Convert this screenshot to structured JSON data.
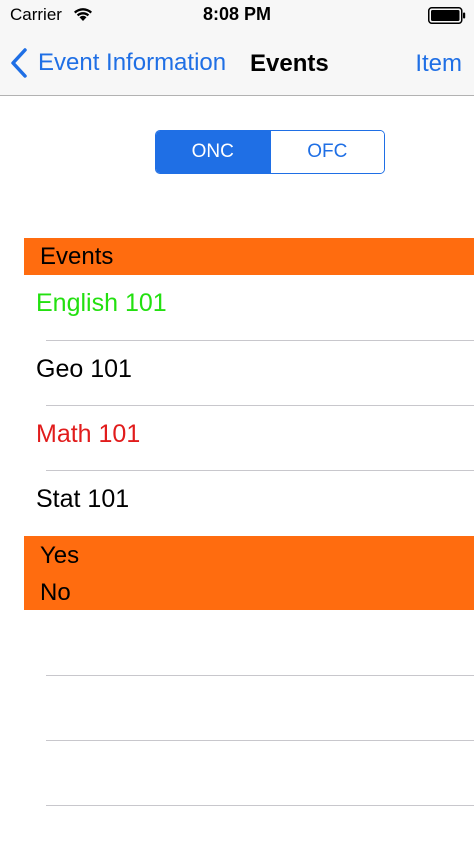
{
  "status_bar": {
    "carrier": "Carrier",
    "time": "8:08 PM",
    "wifi_icon": "wifi-icon",
    "battery_icon": "battery-icon"
  },
  "nav": {
    "back_label": "Event Information",
    "back_icon": "chevron-left-icon",
    "title": "Events",
    "right_label": "Item"
  },
  "segmented": {
    "options": [
      "ONC",
      "OFC"
    ],
    "selected": "ONC"
  },
  "sections": {
    "events_header": "Events",
    "items": [
      {
        "label": "English 101",
        "color": "#23e010"
      },
      {
        "label": "Geo 101",
        "color": "#000000"
      },
      {
        "label": "Math 101",
        "color": "#e11c1c"
      },
      {
        "label": "Stat 101",
        "color": "#000000"
      }
    ],
    "second_header": {
      "line1": "Yes",
      "line2": "No"
    }
  },
  "colors": {
    "accent": "#1f6fe5",
    "header_orange": "#ff6c0f"
  }
}
